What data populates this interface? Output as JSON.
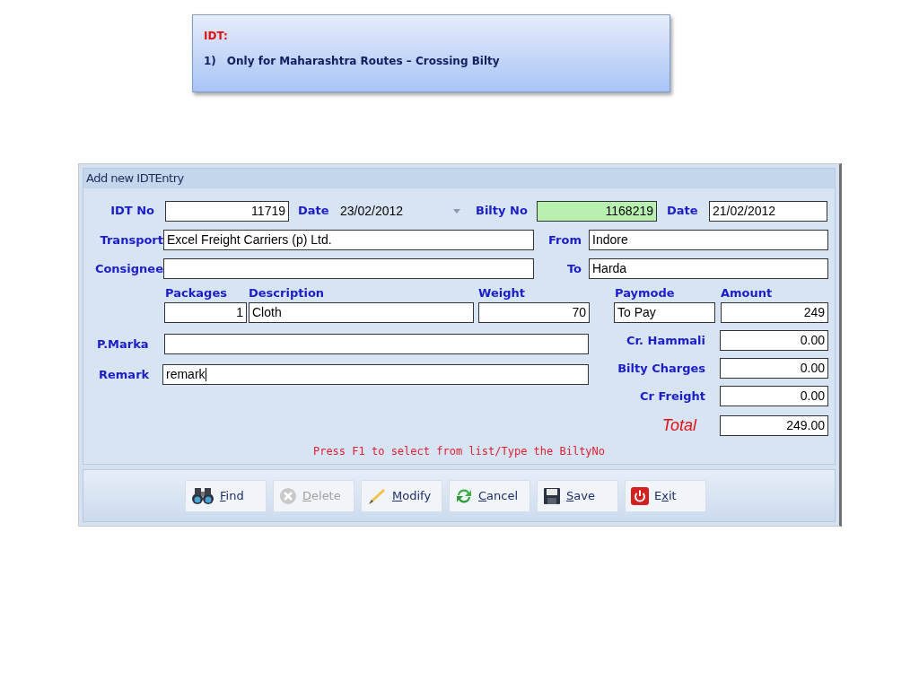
{
  "note": {
    "title": "IDT:",
    "items": [
      {
        "number": "1)",
        "text": "Only for Maharashtra Routes – Crossing Bilty"
      }
    ]
  },
  "window": {
    "title": "Add new IDTEntry"
  },
  "row1": {
    "idt_no": {
      "label": "IDT No",
      "value": "11719"
    },
    "date": {
      "label": "Date",
      "value": "23/02/2012"
    },
    "bilty_no": {
      "label": "Bilty No",
      "value": "1168219",
      "highlighted": true
    },
    "bilty_date": {
      "label": "Date",
      "value": "21/02/2012"
    }
  },
  "transport": {
    "label": "Transport",
    "value": "Excel Freight Carriers (p) Ltd."
  },
  "from": {
    "label": "From",
    "value": "Indore"
  },
  "consignee": {
    "label": "Consignee"
  },
  "to": {
    "label": "To",
    "value": "Harda"
  },
  "goods": {
    "packages": {
      "label": "Packages",
      "value": "1"
    },
    "description": {
      "label": "Description",
      "value": "Cloth"
    },
    "weight": {
      "label": "Weight",
      "value": "70"
    },
    "paymode": {
      "label": "Paymode",
      "value": "To Pay"
    },
    "amount": {
      "label": "Amount",
      "value": "249"
    }
  },
  "p_marka": {
    "label": "P.Marka"
  },
  "remark": {
    "label": "Remark",
    "value": "remark",
    "focused": true
  },
  "charges": [
    {
      "label": "Cr. Hammali",
      "value": "0.00"
    },
    {
      "label": "Bilty Charges",
      "value": "0.00"
    },
    {
      "label": "Cr Freight",
      "value": "0.00"
    }
  ],
  "total": {
    "label": "Total",
    "value": "249.00"
  },
  "hint": "Press F1 to select from list/Type the BiltyNo",
  "buttons": [
    {
      "kind": "find",
      "key": "F",
      "after": "ind",
      "disabled": false
    },
    {
      "kind": "delete",
      "key": "D",
      "after": "elete",
      "disabled": true
    },
    {
      "kind": "modify",
      "key": "M",
      "after": "odify",
      "disabled": false
    },
    {
      "kind": "cancel",
      "key": "C",
      "after": "ancel",
      "disabled": false
    },
    {
      "kind": "save",
      "key": "S",
      "after": "ave",
      "disabled": false
    },
    {
      "kind": "exit",
      "before": "E",
      "key": "x",
      "after": "it",
      "disabled": false
    }
  ]
}
